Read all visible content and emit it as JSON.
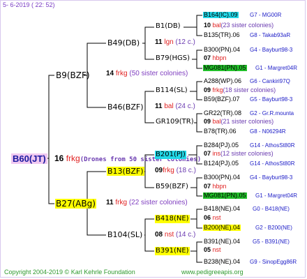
{
  "header": "5-  6-2019 ( 22: 52)",
  "footer_left": "Copyright 2004-2019 © Karl Kehrle Foundation",
  "footer_right": "www.pedigreeapis.org",
  "root": {
    "name": "B60(JT)",
    "num": "16",
    "code": "frkg",
    "note": "(Drones from 50 sister colonies)"
  },
  "gen1": {
    "top": {
      "name": "B9(BZF)"
    },
    "bottom": {
      "name": "B27(ABg)"
    }
  },
  "gen1_connectors": {
    "top": {
      "num": "14",
      "code": "frkg",
      "sis": "(50 sister colonies)"
    },
    "bottom": {
      "num": "11",
      "code": "frkg",
      "sis": "(22 sister colonies)"
    }
  },
  "gen2": [
    {
      "name": "B49(DB)"
    },
    {
      "name": "B46(BZF)"
    },
    {
      "name": "B13(BZF)"
    },
    {
      "name": "B104(SL)"
    }
  ],
  "gen2_connectors": [
    {
      "num": "11",
      "code": "lgn",
      "sis": "(12 c.)"
    },
    {
      "num": "11",
      "code": "bal",
      "sis": "(24 c.)"
    },
    {
      "num": "09",
      "code": "frkg",
      "sis": "(18 c.)"
    },
    {
      "num": "08",
      "code": "nst",
      "sis": "(14 c.)"
    }
  ],
  "gen3": [
    {
      "name": "B1(DB)"
    },
    {
      "name": "B79(HGS)"
    },
    {
      "name": "B114(SL)"
    },
    {
      "name": "GR109(TR)"
    },
    {
      "name": "B201(PJ)"
    },
    {
      "name": "B59(BZF)"
    },
    {
      "name": "B418(NE)"
    },
    {
      "name": "B391(NE)"
    }
  ],
  "gen3_connectors": [
    {
      "num": "10",
      "code": "bal",
      "sis": "(23 sister colonies)"
    },
    {
      "num": "07",
      "code": "hbpn",
      "sis": ""
    },
    {
      "num": "09",
      "code": "frkg",
      "sis": "(18 sister colonies)"
    },
    {
      "num": "09",
      "code": "bal",
      "sis": "(21 sister colonies)"
    },
    {
      "num": "07",
      "code": "ins",
      "sis": "(12 sister colonies)"
    },
    {
      "num": "07",
      "code": "hbpn",
      "sis": ""
    },
    {
      "num": "06",
      "code": "nst",
      "sis": ""
    },
    {
      "num": "05",
      "code": "nst",
      "sis": ""
    }
  ],
  "gen4": [
    {
      "name": "B164(IC).09",
      "right": "G7 - MG00R"
    },
    {
      "name": "B135(TR).06",
      "right": "G8 - Takab93aR"
    },
    {
      "name": "B300(PN).04",
      "right": "G4 - Bayburt98-3"
    },
    {
      "name": "MG081(PN).05",
      "right": "G1 - Margret04R"
    },
    {
      "name": "A288(WP).06",
      "right": "G6 - Cankiri97Q"
    },
    {
      "name": "B59(BZF).07",
      "right": "G5 - Bayburt98-3"
    },
    {
      "name": "GR22(TR).08",
      "right": "G2 - Gr.R.mounta"
    },
    {
      "name": "B78(TR).06",
      "right": "G8 - N06294R"
    },
    {
      "name": "B284(PJ).05",
      "right": "G14 - AthosSt80R"
    },
    {
      "name": "B124(PJ).05",
      "right": "G14 - AthosSt80R"
    },
    {
      "name": "B300(PN).04",
      "right": "G4 - Bayburt98-3"
    },
    {
      "name": "MG081(PN).05",
      "right": "G1 - Margret04R"
    },
    {
      "name": "B418(NE).04",
      "right": "G0 - B418(NE)"
    },
    {
      "name": "B200(NE).04",
      "right": "G2 - B200(NE)"
    },
    {
      "name": "B391(NE).04",
      "right": "G5 - B391(NE)"
    },
    {
      "name": "B238(NE).04",
      "right": "G9 - SinopEgg86R"
    }
  ]
}
